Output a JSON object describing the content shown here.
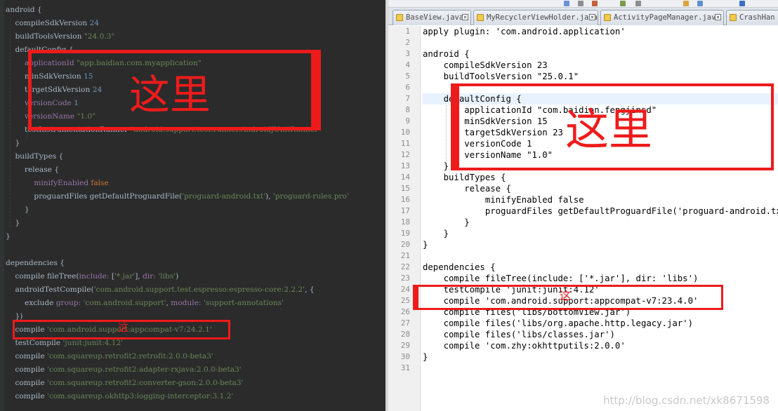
{
  "left_editor": {
    "lines": [
      [
        {
          "t": "android {",
          "c": ""
        }
      ],
      [
        {
          "t": "    compileSdkVersion ",
          "c": ""
        },
        {
          "t": "24",
          "c": "lnum"
        }
      ],
      [
        {
          "t": "    buildToolsVersion ",
          "c": ""
        },
        {
          "t": "\"24.0.3\"",
          "c": "ls"
        }
      ],
      [
        {
          "t": "    defaultConfig {",
          "c": ""
        }
      ],
      [
        {
          "t": "        applicationId ",
          "c": "lp"
        },
        {
          "t": "\"app.baidian.com.myapplication\"",
          "c": "ls"
        }
      ],
      [
        {
          "t": "        minSdkVersion ",
          "c": ""
        },
        {
          "t": "15",
          "c": "lnum"
        }
      ],
      [
        {
          "t": "        targetSdkVersion ",
          "c": ""
        },
        {
          "t": "24",
          "c": "lnum"
        }
      ],
      [
        {
          "t": "        versionCode ",
          "c": "lp"
        },
        {
          "t": "1",
          "c": "lnum"
        }
      ],
      [
        {
          "t": "        versionName ",
          "c": "lp"
        },
        {
          "t": "\"1.0\"",
          "c": "ls"
        }
      ],
      [
        {
          "t": "        testInstrumentationRunner ",
          "c": ""
        },
        {
          "t": "\"android.support.test.runner.AndroidJUnitRunner\"",
          "c": "ls"
        }
      ],
      [
        {
          "t": "    }",
          "c": ""
        }
      ],
      [
        {
          "t": "    buildTypes {",
          "c": ""
        }
      ],
      [
        {
          "t": "        release {",
          "c": ""
        }
      ],
      [
        {
          "t": "            minifyEnabled ",
          "c": "lp"
        },
        {
          "t": "false",
          "c": "lk"
        }
      ],
      [
        {
          "t": "            proguardFiles getDefaultProguardFile(",
          "c": ""
        },
        {
          "t": "'proguard-android.txt'",
          "c": "ls"
        },
        {
          "t": "), ",
          "c": ""
        },
        {
          "t": "'proguard-rules.pro'",
          "c": "ls"
        }
      ],
      [
        {
          "t": "        }",
          "c": ""
        }
      ],
      [
        {
          "t": "    }",
          "c": ""
        }
      ],
      [
        {
          "t": "}",
          "c": ""
        }
      ],
      [
        {
          "t": "",
          "c": ""
        }
      ],
      [
        {
          "t": "dependencies {",
          "c": ""
        }
      ],
      [
        {
          "t": "    compile fileTree(",
          "c": ""
        },
        {
          "t": "include: ",
          "c": "lp"
        },
        {
          "t": "[",
          "c": ""
        },
        {
          "t": "'*.jar'",
          "c": "ls"
        },
        {
          "t": "], ",
          "c": ""
        },
        {
          "t": "dir: ",
          "c": "lp"
        },
        {
          "t": "'libs'",
          "c": "ls"
        },
        {
          "t": ")",
          "c": ""
        }
      ],
      [
        {
          "t": "    androidTestCompile(",
          "c": ""
        },
        {
          "t": "'com.android.support.test.espresso:espresso-core:2.2.2'",
          "c": "ls"
        },
        {
          "t": ", {",
          "c": ""
        }
      ],
      [
        {
          "t": "        exclude ",
          "c": ""
        },
        {
          "t": "group: ",
          "c": "lp"
        },
        {
          "t": "'com.android.support'",
          "c": "ls"
        },
        {
          "t": ", ",
          "c": ""
        },
        {
          "t": "module: ",
          "c": "lp"
        },
        {
          "t": "'support-annotations'",
          "c": "ls"
        }
      ],
      [
        {
          "t": "    })",
          "c": ""
        }
      ],
      [
        {
          "t": "    compile ",
          "c": ""
        },
        {
          "t": "'com.android.support:appcompat-v7:24.2.1'",
          "c": "ls"
        }
      ],
      [
        {
          "t": "    testCompile ",
          "c": ""
        },
        {
          "t": "'junit:junit:4.12'",
          "c": "ls"
        }
      ],
      [
        {
          "t": "    compile ",
          "c": ""
        },
        {
          "t": "'com.squareup.retrofit2:retrofit:2.0.0-beta3'",
          "c": "ls"
        }
      ],
      [
        {
          "t": "    compile ",
          "c": ""
        },
        {
          "t": "'com.squareup.retrofit2:adapter-rxjava:2.0.0-beta3'",
          "c": "ls"
        }
      ],
      [
        {
          "t": "    compile ",
          "c": ""
        },
        {
          "t": "'com.squareup.retrofit2:converter-gson:2.0.0-beta3'",
          "c": "ls"
        }
      ],
      [
        {
          "t": "    compile ",
          "c": ""
        },
        {
          "t": "'com.squareup.okhttp3:logging-interceptor:3.1.2'",
          "c": "ls"
        }
      ]
    ],
    "annotation_label": "这里",
    "annotation_small": "这"
  },
  "tabs": [
    {
      "label": "BaseView.java"
    },
    {
      "label": "MyRecyclerViewHolder.java"
    },
    {
      "label": "ActivityPageManager.java"
    },
    {
      "label": "CrashHan"
    }
  ],
  "right_editor": {
    "line_numbers": [
      "1",
      "2",
      "3",
      "4",
      "5",
      "6",
      "7",
      "8",
      "9",
      "10",
      "11",
      "12",
      "13",
      "14",
      "15",
      "16",
      "17",
      "18",
      "19",
      "20",
      "21",
      "22",
      "23",
      "24",
      "25",
      "26",
      "27",
      "28",
      "29",
      "30",
      "31"
    ],
    "lines": [
      "apply plugin: 'com.android.application'",
      "",
      "android {",
      "    compileSdkVersion 23",
      "    buildToolsVersion \"25.0.1\"",
      "",
      "    defaultConfig {",
      "        applicationId \"com.baidian.fengjinsd\"",
      "        minSdkVersion 15",
      "        targetSdkVersion 23",
      "        versionCode 1",
      "        versionName \"1.0\"",
      "    }",
      "    buildTypes {",
      "        release {",
      "            minifyEnabled false",
      "            proguardFiles getDefaultProguardFile('proguard-android.txt'), 'proguard-rules.pro'",
      "        }",
      "    }",
      "}",
      "",
      "dependencies {",
      "    compile fileTree(include: ['*.jar'], dir: 'libs')",
      "    testCompile 'junit:junit:4.12'",
      "    compile 'com.android.support:appcompat-v7:23.4.0'",
      "    compile files('libs/bottomView.jar')",
      "    compile files('libs/org.apache.http.legacy.jar')",
      "    compile files('libs/classes.jar')",
      "    compile 'com.zhy:okhttputils:2.0.0'",
      "}",
      ""
    ],
    "annotation_label": "这里",
    "annotation_small": "这"
  },
  "watermark": "http://blog.csdn.net/xk8671598",
  "colors": {
    "annotation_red": "#ee1b1b",
    "dark_bg": "#2b2b2b",
    "string_green": "#6a8759",
    "keyword_orange": "#cc7832",
    "property_purple": "#9876aa",
    "number_blue": "#6897bb"
  }
}
